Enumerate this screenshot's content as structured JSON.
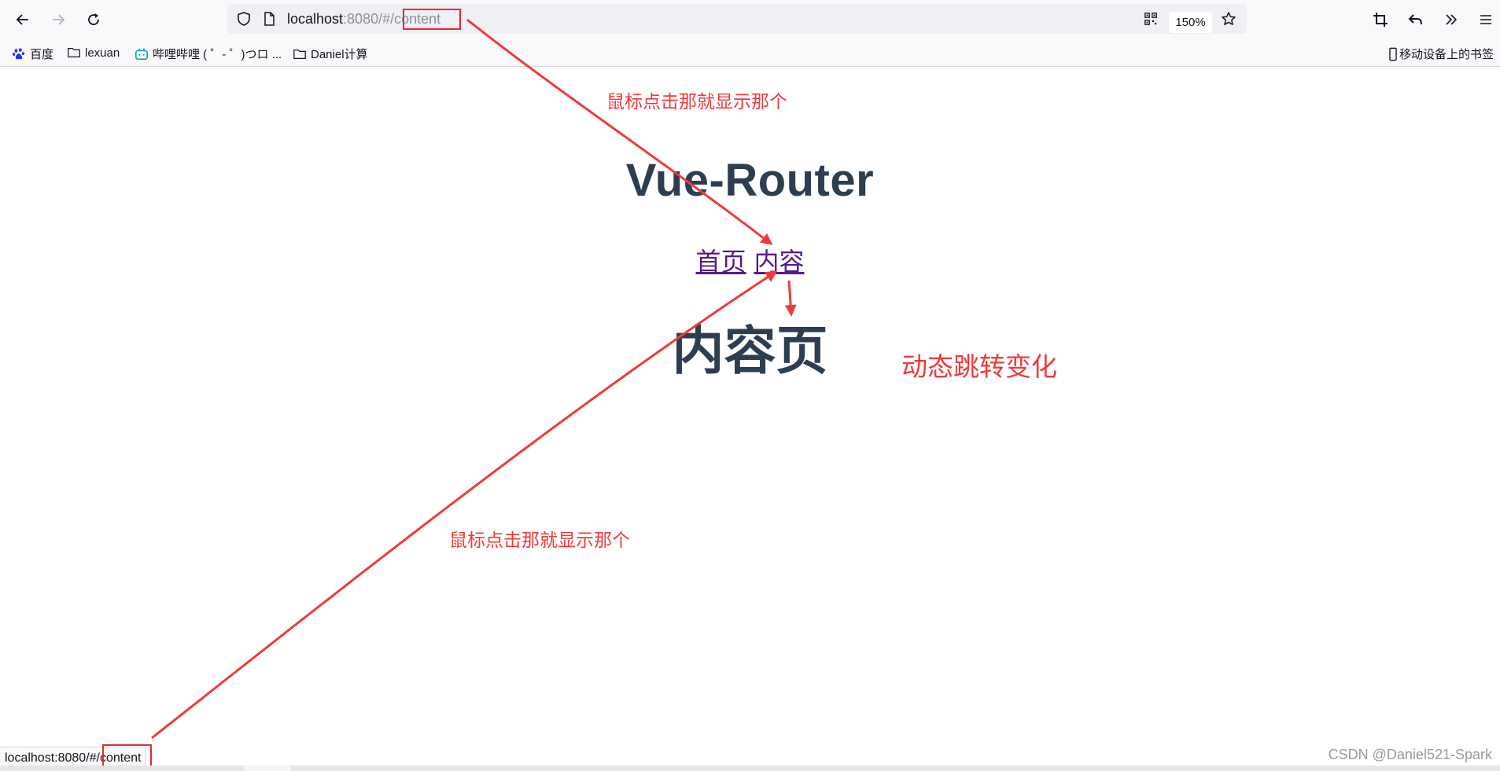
{
  "browser": {
    "url_host": "localhost",
    "url_rest": ":8080/#/",
    "url_path": "content",
    "zoom": "150%",
    "bookmarks": [
      {
        "label": "百度",
        "icon": "baidu-paw-icon"
      },
      {
        "label": "lexuan",
        "icon": "folder-icon"
      },
      {
        "label": "哔哩哔哩 ( ゜- ゜)つロ ...",
        "icon": "bilibili-tv-icon"
      },
      {
        "label": "Daniel计算",
        "icon": "folder-icon"
      }
    ],
    "mobile_bookmarks": "移动设备上的书签"
  },
  "page": {
    "title": "Vue-Router",
    "nav": {
      "home": "首页",
      "content": "内容"
    },
    "heading": "内容页"
  },
  "annotations": {
    "top": "鼠标点击那就显示那个",
    "right": "动态跳转变化",
    "bottom": "鼠标点击那就显示那个"
  },
  "status_bar": {
    "prefix": "localhost:8080/#/",
    "path": "content"
  },
  "watermark": "CSDN @Daniel521-Spark",
  "colors": {
    "annotation": "#f03a3a",
    "heading": "#2c3e50",
    "link": "#551a8b"
  }
}
